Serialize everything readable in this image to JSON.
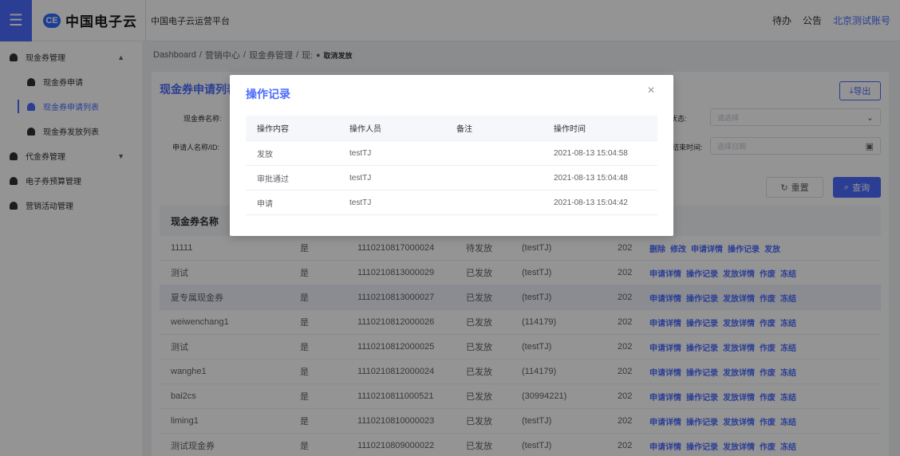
{
  "header": {
    "logo_mark": "CE",
    "logo_text": "中国电子云",
    "platform": "中国电子云运营平台",
    "todo": "待办",
    "notice": "公告",
    "account": "北京测试账号"
  },
  "sidebar": {
    "items": [
      {
        "label": "现金券管理",
        "caret": "▲"
      },
      {
        "label": "现金券申请"
      },
      {
        "label": "现金券申请列表"
      },
      {
        "label": "现金券发放列表"
      },
      {
        "label": "代金券管理",
        "caret": "▼"
      },
      {
        "label": "电子券预算管理"
      },
      {
        "label": "营销活动管理"
      }
    ]
  },
  "breadcrumb": {
    "items": [
      "Dashboard",
      "营销中心",
      "现金券管理",
      "现:"
    ],
    "sep": "/",
    "last": "取消发放"
  },
  "card": {
    "title": "现金券申请列表",
    "export": "导出"
  },
  "form": {
    "name_label": "现金券名称:",
    "applicant_label": "申请人名称/ID:",
    "status_label": "状态:",
    "status_placeholder": "请选择",
    "end_time_label": "结束时间:",
    "end_time_placeholder": "选择日期",
    "reset": "重置",
    "query": "查询"
  },
  "table": {
    "headers": [
      "现金券名称",
      "",
      "",
      "",
      "",
      "",
      ""
    ],
    "rows": [
      {
        "name": "11111",
        "flag": "是",
        "id": "1110210817000024",
        "status": "待发放",
        "applicant": "(testTJ)",
        "time": "202",
        "actions": [
          "删除",
          "修改",
          "申请详情",
          "操作记录",
          "发放"
        ]
      },
      {
        "name": "测试",
        "flag": "是",
        "id": "1110210813000029",
        "status": "已发放",
        "applicant": "(testTJ)",
        "time": "202",
        "actions": [
          "申请详情",
          "操作记录",
          "发放详情",
          "作废",
          "冻结"
        ]
      },
      {
        "name": "夏专属现金券",
        "flag": "是",
        "id": "1110210813000027",
        "status": "已发放",
        "applicant": "(testTJ)",
        "time": "202",
        "actions": [
          "申请详情",
          "操作记录",
          "发放详情",
          "作废",
          "冻结"
        ]
      },
      {
        "name": "weiwenchang1",
        "flag": "是",
        "id": "1110210812000026",
        "status": "已发放",
        "applicant": "(114179)",
        "time": "202",
        "actions": [
          "申请详情",
          "操作记录",
          "发放详情",
          "作废",
          "冻结"
        ]
      },
      {
        "name": "测试",
        "flag": "是",
        "id": "1110210812000025",
        "status": "已发放",
        "applicant": "(testTJ)",
        "time": "202",
        "actions": [
          "申请详情",
          "操作记录",
          "发放详情",
          "作废",
          "冻结"
        ]
      },
      {
        "name": "wanghe1",
        "flag": "是",
        "id": "1110210812000024",
        "status": "已发放",
        "applicant": "(114179)",
        "time": "202",
        "actions": [
          "申请详情",
          "操作记录",
          "发放详情",
          "作废",
          "冻结"
        ]
      },
      {
        "name": "bai2cs",
        "flag": "是",
        "id": "1110210811000521",
        "status": "已发放",
        "applicant": "(30994221)",
        "time": "202",
        "actions": [
          "申请详情",
          "操作记录",
          "发放详情",
          "作废",
          "冻结"
        ]
      },
      {
        "name": "liming1",
        "flag": "是",
        "id": "1110210810000023",
        "status": "已发放",
        "applicant": "(testTJ)",
        "time": "202",
        "actions": [
          "申请详情",
          "操作记录",
          "发放详情",
          "作废",
          "冻结"
        ]
      },
      {
        "name": "测试现金券",
        "flag": "是",
        "id": "1110210809000022",
        "status": "已发放",
        "applicant": "(testTJ)",
        "time": "202",
        "actions": [
          "申请详情",
          "操作记录",
          "发放详情",
          "作废",
          "冻结"
        ]
      }
    ]
  },
  "dialog": {
    "title": "操作记录",
    "close": "×",
    "headers": [
      "操作内容",
      "操作人员",
      "备注",
      "操作时间"
    ],
    "rows": [
      {
        "action": "发放",
        "operator": "testTJ",
        "note": "",
        "time": "2021-08-13 15:04:58"
      },
      {
        "action": "审批通过",
        "operator": "testTJ",
        "note": "",
        "time": "2021-08-13 15:04:48"
      },
      {
        "action": "申请",
        "operator": "testTJ",
        "note": "",
        "time": "2021-08-13 15:04:42"
      }
    ]
  },
  "colors": {
    "accent": "#4b6bff",
    "overlay": "rgba(0,0,0,0.42)"
  }
}
